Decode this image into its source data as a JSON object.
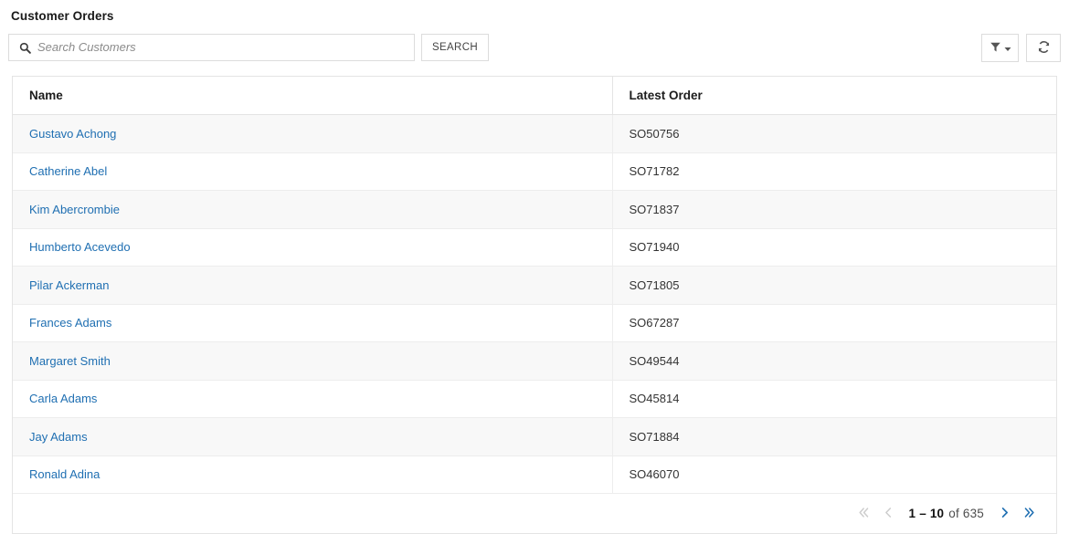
{
  "panel": {
    "title": "Customer Orders"
  },
  "search": {
    "icon": "search-icon",
    "value": "",
    "placeholder": "Search Customers",
    "button_label": "SEARCH"
  },
  "toolbar": {
    "filter_icon": "funnel-icon",
    "filter_caret_icon": "caret-down-icon",
    "refresh_icon": "refresh-icon"
  },
  "table": {
    "columns": [
      "Name",
      "Latest Order"
    ],
    "rows": [
      {
        "name": "Gustavo Achong",
        "order": "SO50756"
      },
      {
        "name": "Catherine Abel",
        "order": "SO71782"
      },
      {
        "name": "Kim Abercrombie",
        "order": "SO71837"
      },
      {
        "name": "Humberto Acevedo",
        "order": "SO71940"
      },
      {
        "name": "Pilar Ackerman",
        "order": "SO71805"
      },
      {
        "name": "Frances Adams",
        "order": "SO67287"
      },
      {
        "name": "Margaret Smith",
        "order": "SO49544"
      },
      {
        "name": "Carla Adams",
        "order": "SO45814"
      },
      {
        "name": "Jay Adams",
        "order": "SO71884"
      },
      {
        "name": "Ronald Adina",
        "order": "SO46070"
      }
    ]
  },
  "pagination": {
    "first_icon": "double-chevron-left-icon",
    "prev_icon": "chevron-left-icon",
    "range": "1 – 10",
    "total": "of 635",
    "next_icon": "chevron-right-icon",
    "last_icon": "double-chevron-right-icon",
    "first_enabled": false,
    "prev_enabled": false,
    "next_enabled": true,
    "last_enabled": true
  },
  "colors": {
    "link": "#1f6fb2",
    "border": "#e4e4e4",
    "row_alt": "#f8f8f8",
    "text": "#333333",
    "muted": "#8b8b8b"
  }
}
